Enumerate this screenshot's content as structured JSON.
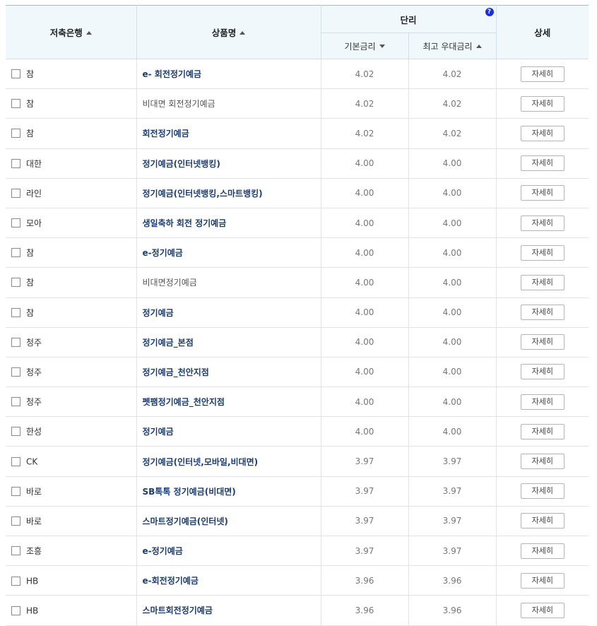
{
  "header": {
    "bank_col": "저축은행",
    "product_col": "상품명",
    "simple_rate_group": "단리",
    "help_icon_text": "?",
    "base_rate_col": "기본금리",
    "max_rate_col": "최고 우대금리",
    "detail_col": "상세"
  },
  "detail_button_label": "자세히",
  "rows": [
    {
      "bank": "참",
      "product": "e- 회전정기예금",
      "base": "4.02",
      "max": "4.02",
      "style": "link"
    },
    {
      "bank": "참",
      "product": "비대면 회전정기예금",
      "base": "4.02",
      "max": "4.02",
      "style": "plain"
    },
    {
      "bank": "참",
      "product": "회전정기예금",
      "base": "4.02",
      "max": "4.02",
      "style": "link"
    },
    {
      "bank": "대한",
      "product": "정기예금(인터넷뱅킹)",
      "base": "4.00",
      "max": "4.00",
      "style": "link"
    },
    {
      "bank": "라인",
      "product": "정기예금(인터넷뱅킹,스마트뱅킹)",
      "base": "4.00",
      "max": "4.00",
      "style": "link"
    },
    {
      "bank": "모아",
      "product": "생일축하 회전 정기예금",
      "base": "4.00",
      "max": "4.00",
      "style": "link"
    },
    {
      "bank": "참",
      "product": "e-정기예금",
      "base": "4.00",
      "max": "4.00",
      "style": "link"
    },
    {
      "bank": "참",
      "product": "비대면정기예금",
      "base": "4.00",
      "max": "4.00",
      "style": "plain"
    },
    {
      "bank": "참",
      "product": "정기예금",
      "base": "4.00",
      "max": "4.00",
      "style": "link"
    },
    {
      "bank": "청주",
      "product": "정기예금_본점",
      "base": "4.00",
      "max": "4.00",
      "style": "link"
    },
    {
      "bank": "청주",
      "product": "정기예금_천안지점",
      "base": "4.00",
      "max": "4.00",
      "style": "link"
    },
    {
      "bank": "청주",
      "product": "펫팸정기예금_천안지점",
      "base": "4.00",
      "max": "4.00",
      "style": "link"
    },
    {
      "bank": "한성",
      "product": "정기예금",
      "base": "4.00",
      "max": "4.00",
      "style": "link"
    },
    {
      "bank": "CK",
      "product": "정기예금(인터넷,모바일,비대면)",
      "base": "3.97",
      "max": "3.97",
      "style": "link"
    },
    {
      "bank": "바로",
      "product": "SB톡톡 정기예금(비대면)",
      "base": "3.97",
      "max": "3.97",
      "style": "link"
    },
    {
      "bank": "바로",
      "product": "스마트정기예금(인터넷)",
      "base": "3.97",
      "max": "3.97",
      "style": "link"
    },
    {
      "bank": "조흥",
      "product": "e-정기예금",
      "base": "3.97",
      "max": "3.97",
      "style": "link"
    },
    {
      "bank": "HB",
      "product": "e-회전정기예금",
      "base": "3.96",
      "max": "3.96",
      "style": "link"
    },
    {
      "bank": "HB",
      "product": "스마트회전정기예금",
      "base": "3.96",
      "max": "3.96",
      "style": "link"
    }
  ]
}
